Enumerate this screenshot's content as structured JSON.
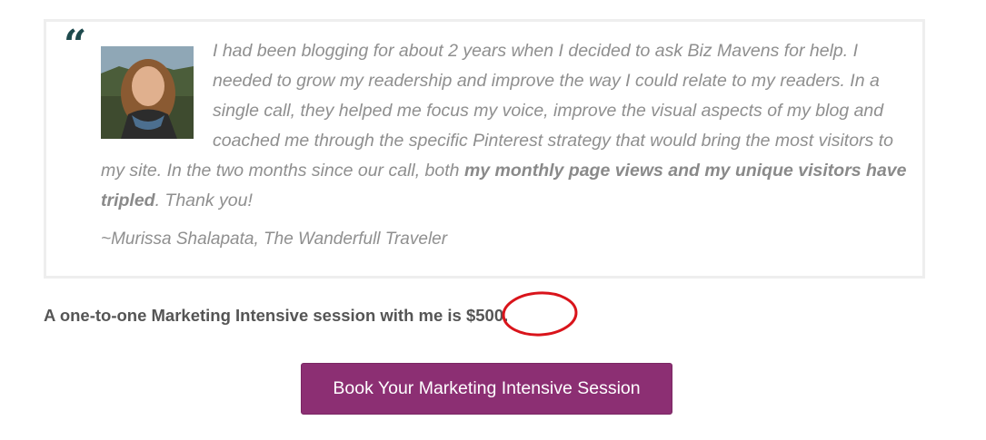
{
  "testimonial": {
    "quote_mark": "“",
    "photo_icon": "person-photo",
    "text_part1": "I had been blogging for about 2 years when I decided to ask Biz Mavens for help. I needed to grow my readership and improve the way I could relate to my readers. In a single call, they helped me focus my voice, improve the visual aspects of my blog and coached me through the specific Pinterest strategy that would bring the most visitors to my site. In the two months since our call, both ",
    "text_bold": "my monthly page views and my unique visitors have tripled",
    "text_part2": ". Thank you!",
    "attribution": "~Murissa Shalapata, The Wanderfull Traveler"
  },
  "offer": {
    "text": "A one-to-one Marketing Intensive session with me is ",
    "price": "$500."
  },
  "cta": {
    "label": "Book Your Marketing Intensive Session"
  },
  "colors": {
    "button_background": "#8c2f73",
    "quote_mark": "#1e4a4d",
    "annotation_circle": "#d9141b",
    "testimonial_text": "#8f8f8f"
  }
}
